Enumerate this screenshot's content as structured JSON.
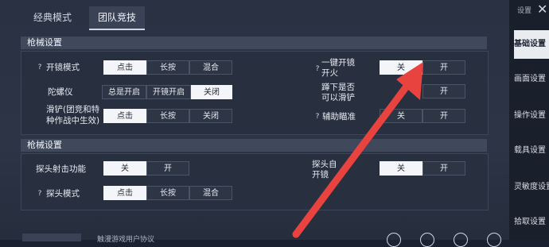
{
  "tabs": [
    "经典模式",
    "团队竞技"
  ],
  "sections": [
    {
      "title": "枪械设置"
    },
    {
      "title": "枪械设置"
    }
  ],
  "rows": {
    "scope_mode": {
      "label": "开镜模式",
      "options": [
        "点击",
        "长按",
        "混合"
      ],
      "selected": 0
    },
    "gyro": {
      "label": "陀螺仪",
      "options": [
        "总是开启",
        "开镜开启",
        "关闭"
      ],
      "selected": 2
    },
    "slide": {
      "label_line1": "滑铲(团竞和特",
      "label_line2": "种作战中生效)",
      "options": [
        "点击",
        "长按",
        "关闭"
      ],
      "selected": 0
    },
    "one_key_fire": {
      "label_line1": "一键开镜",
      "label_line2": "开火",
      "options": [
        "关",
        "开"
      ],
      "selected": 0
    },
    "crouch_slide": {
      "label_line1": "蹲下是否",
      "label_line2": "可以滑铲",
      "options": [
        "开"
      ],
      "selected": -1
    },
    "aim_assist": {
      "label": "辅助瞄准",
      "options": [
        "关",
        "开"
      ],
      "selected": -1
    },
    "peek_fire": {
      "label": "探头射击功能",
      "options": [
        "关",
        "开"
      ],
      "selected": 0
    },
    "peek_mode": {
      "label": "探头模式",
      "options": [
        "点击",
        "长按",
        "混合"
      ],
      "selected": 0
    },
    "peek_auto": {
      "label_line1": "探头自",
      "label_line2": "开镜",
      "options": [
        "关",
        "开"
      ],
      "selected": 0
    }
  },
  "sidebar": {
    "title": "设置",
    "items": [
      "基础设置",
      "画面设置",
      "操作设置",
      "载具设置",
      "灵敏度设置",
      "拾取设置"
    ],
    "active": 0
  },
  "footer": {
    "text": "触漫游戏用户协议"
  },
  "icons": {
    "help": "question-icon",
    "close": "close-icon"
  },
  "colors": {
    "selected": "#f3f5f8",
    "arrow": "#e8433f",
    "background": "#2a3142"
  }
}
